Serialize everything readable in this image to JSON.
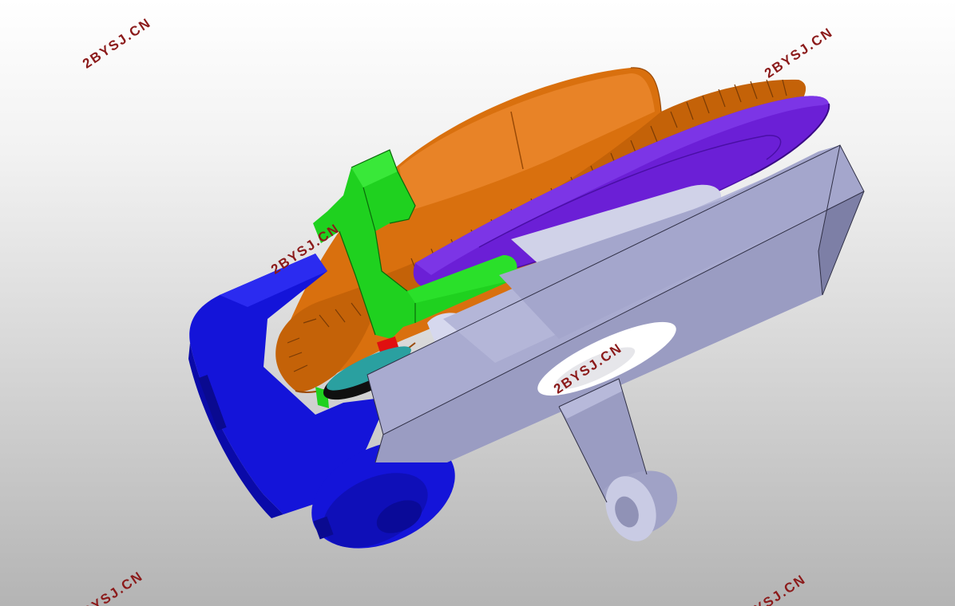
{
  "watermark": {
    "text": "2BYSJ.CN",
    "color": "#8b1a1a"
  },
  "part_colors": {
    "pulley": "#d9700e",
    "disc": "#6b1fd6",
    "clamp": "#1fd11f",
    "housing": "#1414d9",
    "base_plate": "#a6a8cc",
    "pin": "#e01010"
  }
}
